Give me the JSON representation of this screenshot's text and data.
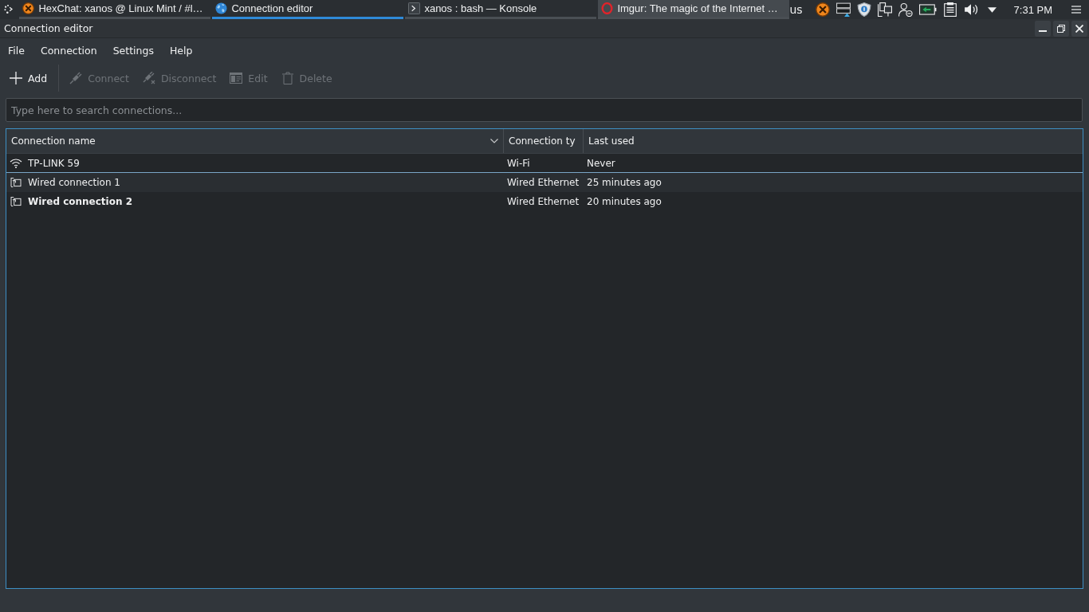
{
  "taskbar": {
    "tasks": [
      {
        "kind": "chat",
        "title": "HexChat: xanos @ Linux Mint / #l…",
        "selected": false,
        "hovered": false
      },
      {
        "kind": "network",
        "title": "Connection editor",
        "selected": true,
        "hovered": false
      },
      {
        "kind": "terminal",
        "title": "xanos : bash — Konsole",
        "selected": false,
        "hovered": false
      },
      {
        "kind": "browser",
        "title": "Imgur: The magic of the Internet …",
        "selected": false,
        "hovered": true
      }
    ],
    "keyboard_layout": "us",
    "clock": "7:31 PM"
  },
  "window": {
    "title": "Connection editor"
  },
  "menu": [
    {
      "label": "File"
    },
    {
      "label": "Connection"
    },
    {
      "label": "Settings"
    },
    {
      "label": "Help"
    }
  ],
  "toolbar": [
    {
      "kind": "add",
      "label": "Add",
      "disabled": false
    },
    {
      "kind": "connect",
      "label": "Connect",
      "disabled": true
    },
    {
      "kind": "disconnect",
      "label": "Disconnect",
      "disabled": true
    },
    {
      "kind": "edit",
      "label": "Edit",
      "disabled": true
    },
    {
      "kind": "delete",
      "label": "Delete",
      "disabled": true
    }
  ],
  "search": {
    "placeholder": "Type here to search connections..."
  },
  "table": {
    "columns": [
      {
        "label": "Connection name",
        "sorted": true
      },
      {
        "label": "Connection ty",
        "sorted": false
      },
      {
        "label": "Last used",
        "sorted": false
      }
    ],
    "rows": [
      {
        "kind": "wifi",
        "name": "TP-LINK 59",
        "type": "Wi-Fi",
        "last_used": "Never",
        "active": false,
        "focused": true
      },
      {
        "kind": "wired",
        "name": "Wired connection 1",
        "type": "Wired Ethernet",
        "last_used": "25 minutes ago",
        "active": false,
        "focused": false
      },
      {
        "kind": "wired",
        "name": "Wired connection 2",
        "type": "Wired Ethernet",
        "last_used": "20 minutes ago",
        "active": true,
        "focused": false
      }
    ]
  }
}
